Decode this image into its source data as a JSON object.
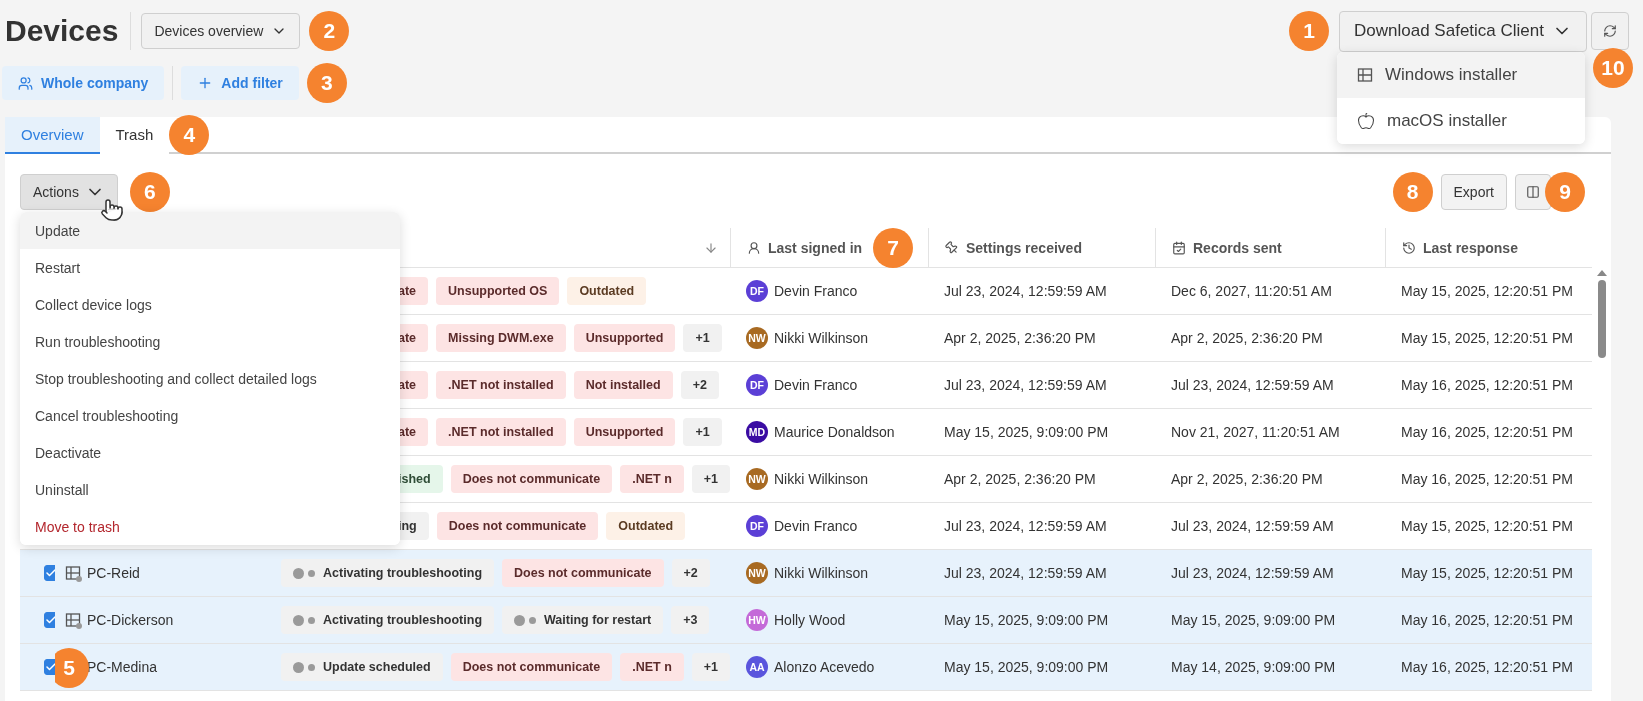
{
  "page": {
    "title": "Devices",
    "view_select": {
      "value": "Devices overview",
      "callout": "2"
    }
  },
  "download": {
    "label": "Download Safetica Client",
    "callout": "1",
    "expanded": true,
    "menu": [
      {
        "label": "Windows installer",
        "kind": "windows",
        "highlighted": true
      },
      {
        "label": "macOS installer",
        "kind": "macos",
        "highlighted": false
      }
    ]
  },
  "refresh": {
    "callout": "10"
  },
  "filters": {
    "scope": "Whole company",
    "add": "Add filter",
    "callout": "3"
  },
  "tabs": [
    {
      "label": "Overview",
      "selected": true
    },
    {
      "label": "Trash",
      "selected": false
    }
  ],
  "tabs_callout": "4",
  "actions": {
    "label": "Actions",
    "callout": "6",
    "expanded": true,
    "menu": [
      {
        "label": "Update",
        "kind": "normal",
        "highlighted": true
      },
      {
        "label": "Restart",
        "kind": "normal",
        "highlighted": false
      },
      {
        "label": "Collect device logs",
        "kind": "normal",
        "highlighted": false
      },
      {
        "label": "Run troubleshooting",
        "kind": "normal",
        "highlighted": false
      },
      {
        "label": "Stop troubleshooting and collect detailed logs",
        "kind": "normal",
        "highlighted": false
      },
      {
        "label": "Cancel troubleshooting",
        "kind": "normal",
        "highlighted": false
      },
      {
        "label": "Deactivate",
        "kind": "normal",
        "highlighted": false
      },
      {
        "label": "Uninstall",
        "kind": "normal",
        "highlighted": false
      },
      {
        "label": "Move to trash",
        "kind": "danger",
        "highlighted": false
      }
    ]
  },
  "export": {
    "label": "Export",
    "callout": "8"
  },
  "columns_button": {
    "callout": "9"
  },
  "table": {
    "columns": [
      {
        "kind": "sort"
      },
      {
        "label": "Last signed in",
        "kind": "user",
        "callout": "7"
      },
      {
        "label": "Settings received",
        "kind": "pin"
      },
      {
        "label": "Records sent",
        "kind": "calendar"
      },
      {
        "label": "Last response",
        "kind": "history"
      }
    ],
    "selection_callout": "5",
    "rows": [
      {
        "selected": false,
        "tags": [
          {
            "label": "ate",
            "kind": "error"
          },
          {
            "label": "Unsupported OS",
            "kind": "error"
          },
          {
            "label": "Outdated",
            "kind": "warning"
          }
        ],
        "user": {
          "initials": "DF",
          "name": "Devin Franco",
          "color": "#5b3fd6"
        },
        "settings_received": "Jul 23, 2024, 12:59:59 AM",
        "records_sent": "Dec 6, 2027, 11:20:51 AM",
        "last_response": "May 15, 2025, 12:20:51 PM"
      },
      {
        "selected": false,
        "tags": [
          {
            "label": "ate",
            "kind": "error"
          },
          {
            "label": "Missing DWM.exe",
            "kind": "error"
          },
          {
            "label": "Unsupported",
            "kind": "error"
          },
          {
            "label": "+1",
            "kind": "more"
          }
        ],
        "user": {
          "initials": "NW",
          "name": "Nikki Wilkinson",
          "color": "#a86a22"
        },
        "settings_received": "Apr 2, 2025, 2:36:20 PM",
        "records_sent": "Apr 2, 2025, 2:36:20 PM",
        "last_response": "May 15, 2025, 12:20:51 PM"
      },
      {
        "selected": false,
        "tags": [
          {
            "label": "ate",
            "kind": "error"
          },
          {
            "label": ".NET not installed",
            "kind": "error"
          },
          {
            "label": "Not installed",
            "kind": "error"
          },
          {
            "label": "+2",
            "kind": "more"
          }
        ],
        "user": {
          "initials": "DF",
          "name": "Devin Franco",
          "color": "#5b3fd6"
        },
        "settings_received": "Jul 23, 2024, 12:59:59 AM",
        "records_sent": "Jul 23, 2024, 12:59:59 AM",
        "last_response": "May 16, 2025, 12:20:51 PM"
      },
      {
        "selected": false,
        "tags": [
          {
            "label": "ate",
            "kind": "error"
          },
          {
            "label": ".NET not installed",
            "kind": "error"
          },
          {
            "label": "Unsupported",
            "kind": "error"
          },
          {
            "label": "+1",
            "kind": "more"
          }
        ],
        "user": {
          "initials": "MD",
          "name": "Maurice Donaldson",
          "color": "#3a0ca3"
        },
        "settings_received": "May 15, 2025, 9:09:00 PM",
        "records_sent": "Nov 21, 2027, 11:20:51 AM",
        "last_response": "May 16, 2025, 12:20:51 PM"
      },
      {
        "selected": false,
        "tags": [
          {
            "label": "ished",
            "kind": "success"
          },
          {
            "label": "Does not communicate",
            "kind": "error"
          },
          {
            "label": ".NET n",
            "kind": "error"
          },
          {
            "label": "+1",
            "kind": "more"
          }
        ],
        "user": {
          "initials": "NW",
          "name": "Nikki Wilkinson",
          "color": "#a86a22"
        },
        "settings_received": "Apr 2, 2025, 2:36:20 PM",
        "records_sent": "Apr 2, 2025, 2:36:20 PM",
        "last_response": "May 16, 2025, 12:20:51 PM"
      },
      {
        "selected": false,
        "tags": [
          {
            "label": "ing",
            "kind": "neutral"
          },
          {
            "label": "Does not communicate",
            "kind": "error"
          },
          {
            "label": "Outdated",
            "kind": "warning"
          }
        ],
        "user": {
          "initials": "DF",
          "name": "Devin Franco",
          "color": "#5b3fd6"
        },
        "settings_received": "Jul 23, 2024, 12:59:59 AM",
        "records_sent": "Jul 23, 2024, 12:59:59 AM",
        "last_response": "May 15, 2025, 12:20:51 PM"
      },
      {
        "selected": true,
        "device": "PC-Reid",
        "tags": [
          {
            "label": "Activating troubleshooting",
            "kind": "progress"
          },
          {
            "label": "Does not communicate",
            "kind": "error"
          },
          {
            "label": "+2",
            "kind": "more"
          }
        ],
        "user": {
          "initials": "NW",
          "name": "Nikki Wilkinson",
          "color": "#a86a22"
        },
        "settings_received": "Jul 23, 2024, 12:59:59 AM",
        "records_sent": "Jul 23, 2024, 12:59:59 AM",
        "last_response": "May 15, 2025, 12:20:51 PM"
      },
      {
        "selected": true,
        "device": "PC-Dickerson",
        "tags": [
          {
            "label": "Activating troubleshooting",
            "kind": "progress"
          },
          {
            "label": "Waiting for restart",
            "kind": "progress"
          },
          {
            "label": "+3",
            "kind": "more"
          }
        ],
        "user": {
          "initials": "HW",
          "name": "Holly Wood",
          "color": "#c46ad8"
        },
        "settings_received": "May 15, 2025, 9:09:00 PM",
        "records_sent": "May 15, 2025, 9:09:00 PM",
        "last_response": "May 16, 2025, 12:20:51 PM"
      },
      {
        "selected": true,
        "device": "PC-Medina",
        "tags": [
          {
            "label": "Update scheduled",
            "kind": "progress"
          },
          {
            "label": "Does not communicate",
            "kind": "error"
          },
          {
            "label": ".NET n",
            "kind": "error"
          },
          {
            "label": "+1",
            "kind": "more"
          }
        ],
        "user": {
          "initials": "AA",
          "name": "Alonzo Acevedo",
          "color": "#5a55dd"
        },
        "settings_received": "May 15, 2025, 9:09:00 PM",
        "records_sent": "May 14, 2025, 9:09:00 PM",
        "last_response": "May 16, 2025, 12:20:51 PM"
      }
    ]
  }
}
